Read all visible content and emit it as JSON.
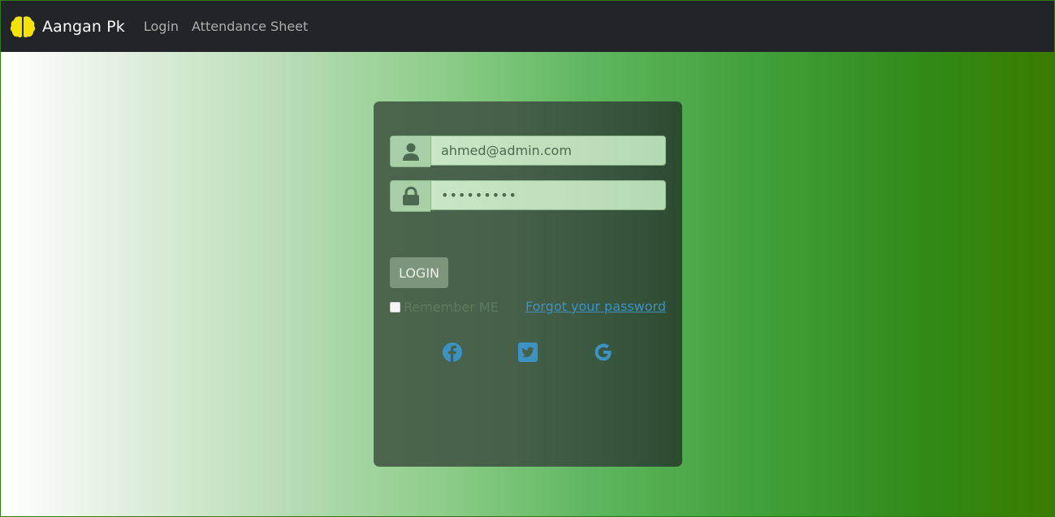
{
  "navbar": {
    "brand": "Aangan Pk",
    "links": [
      "Login",
      "Attendance Sheet"
    ],
    "background": "#212529",
    "logo_color": "#f5e400"
  },
  "login_form": {
    "email_value": "ahmed@admin.com",
    "password_value": "•••••••••",
    "login_button": "LOGIN",
    "remember_label": "Remember ME",
    "remember_checked": false,
    "forgot_link": "Forgot your password",
    "social_icons": [
      "facebook-icon",
      "twitter-icon",
      "google-icon"
    ],
    "accent_color": "#3d92c4"
  }
}
